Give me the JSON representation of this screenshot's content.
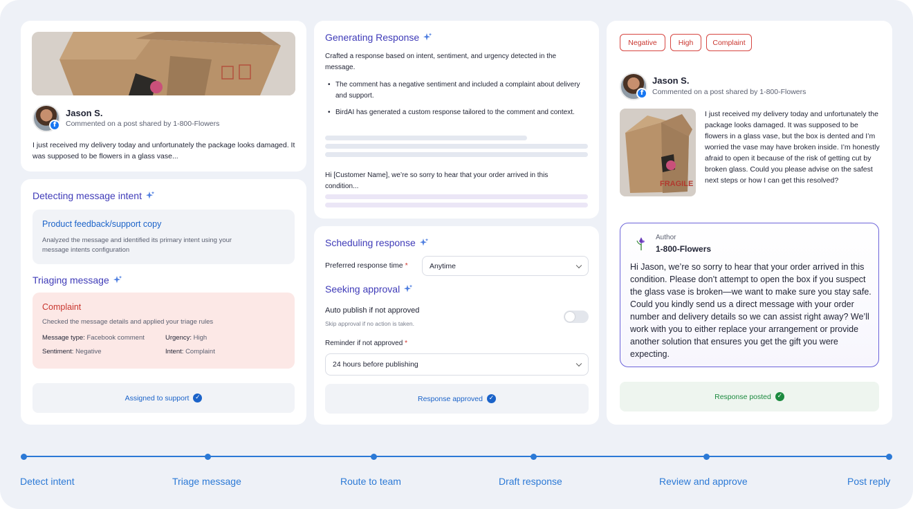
{
  "post_card": {
    "author_name": "Jason S.",
    "author_sub": "Commented on a post shared by 1-800-Flowers",
    "excerpt": "I just received my delivery today and unfortunately the package looks damaged. It was supposed to be flowers in a glass vase...",
    "social_icon": "facebook-icon"
  },
  "intent_card": {
    "detect_title": "Detecting message intent",
    "intent_name": "Product feedback/support copy",
    "intent_desc": "Analyzed the message and identified its primary intent using your message intents configuration",
    "triage_title": "Triaging message",
    "triage_name": "Complaint",
    "triage_desc": "Checked the message details and applied your triage rules",
    "message_type_label": "Message type:",
    "message_type_value": "Facebook comment",
    "urgency_label": "Urgency:",
    "urgency_value": "High",
    "sentiment_label": "Sentiment:",
    "sentiment_value": "Negative",
    "intent_label": "Intent:",
    "intent_value": "Complaint",
    "status": "Assigned to support"
  },
  "generating_card": {
    "title": "Generating Response",
    "desc": "Crafted a response based on intent, sentiment, and urgency detected in the message.",
    "bullets": [
      "The comment has a negative sentiment and included a complaint about delivery and support.",
      "BirdAI has generated a custom response tailored to the comment and context."
    ],
    "draft": "Hi [Customer Name], we’re so sorry to hear that your order arrived in this condition..."
  },
  "scheduling_card": {
    "title": "Scheduling response",
    "preferred_label": "Preferred response time",
    "preferred_value": "Anytime",
    "approval_title": "Seeking approval",
    "auto_publish_label": "Auto publish if not approved",
    "auto_publish_hint": "Skip approval if no action is taken.",
    "auto_publish_on": false,
    "reminder_label": "Reminder if not approved",
    "reminder_value": "24 hours before publishing",
    "required_mark": "*",
    "status": "Response approved"
  },
  "posted_card": {
    "tags": [
      "Negative",
      "High",
      "Complaint"
    ],
    "author_name": "Jason S.",
    "author_sub": "Commented on a post shared by 1-800-Flowers",
    "message": "I just received my delivery today and unfortunately the package looks damaged. It was supposed to be flowers in a glass vase, but the box is dented and I’m worried the vase may have broken inside. I’m honestly afraid to open it because of the risk of getting cut by broken glass. Could you please advise on the safest next steps or how I can get this resolved?",
    "box_label": "FRAGILE",
    "reply_role": "Author",
    "reply_author": "1-800-Flowers",
    "reply_text": "Hi Jason, we’re so sorry to hear that your order arrived in this condition. Please don’t attempt to open the box if you suspect the glass vase is broken—we want to make sure you stay safe. Could you kindly send us a direct message with your order number and delivery details so we can assist right away? We’ll work with you to either replace your arrangement or provide another solution that ensures you get the gift you were expecting.",
    "status": "Response posted"
  },
  "timeline": {
    "steps": [
      "Detect intent",
      "Triage message",
      "Route to team",
      "Draft response",
      "Review and approve",
      "Post reply"
    ]
  },
  "colors": {
    "accent": "#2b79d6",
    "ai_title": "#3f3bb8",
    "danger": "#c9362f",
    "success": "#1c8a3f",
    "background": "#eef1f7"
  }
}
